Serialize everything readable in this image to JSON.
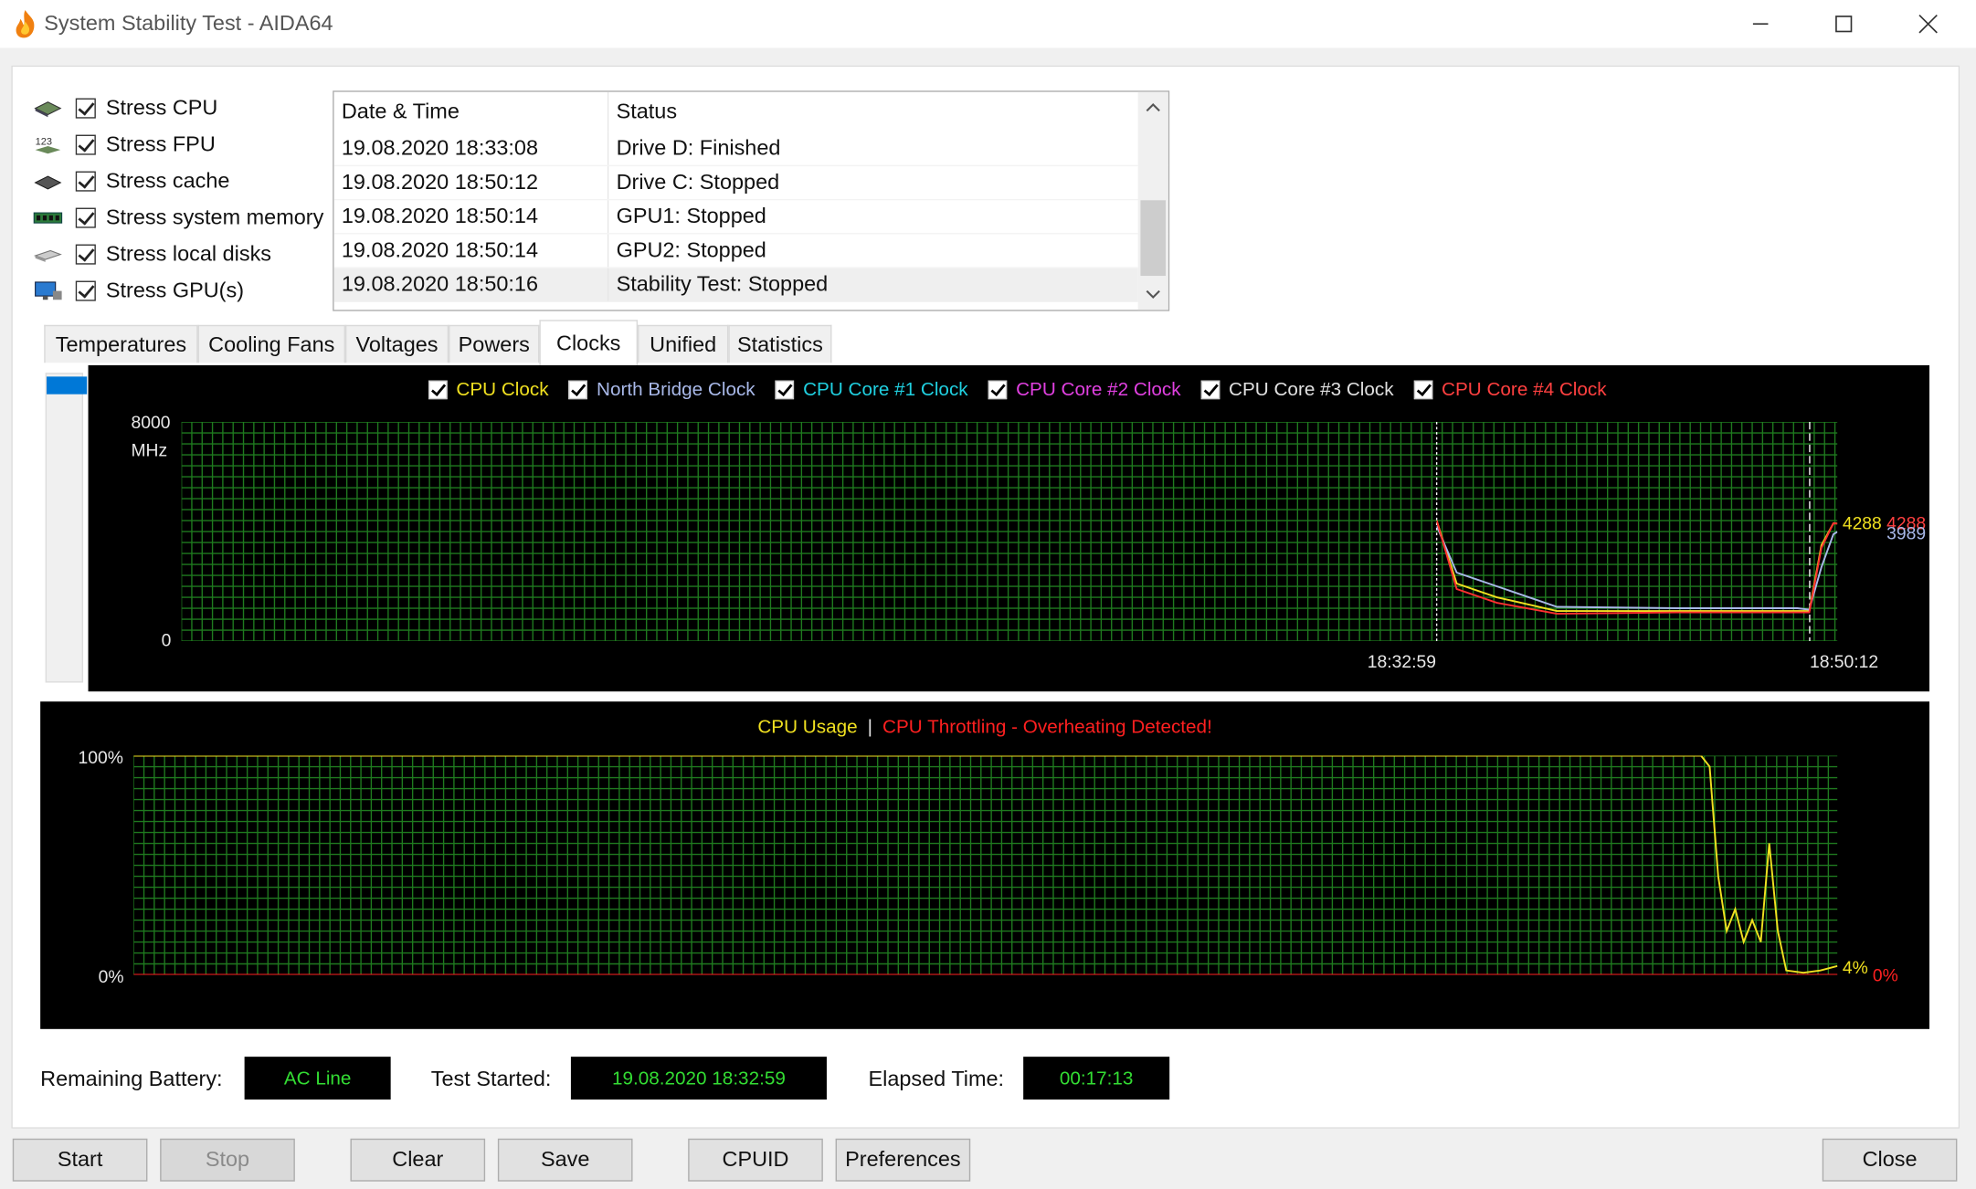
{
  "window": {
    "title": "System Stability Test - AIDA64"
  },
  "stress_options": [
    {
      "label": "Stress CPU",
      "checked": true,
      "icon": "cpu-icon"
    },
    {
      "label": "Stress FPU",
      "checked": true,
      "icon": "fpu-icon"
    },
    {
      "label": "Stress cache",
      "checked": true,
      "icon": "cache-icon"
    },
    {
      "label": "Stress system memory",
      "checked": true,
      "icon": "memory-icon"
    },
    {
      "label": "Stress local disks",
      "checked": true,
      "icon": "disk-icon"
    },
    {
      "label": "Stress GPU(s)",
      "checked": true,
      "icon": "gpu-icon"
    }
  ],
  "log": {
    "columns": [
      "Date & Time",
      "Status"
    ],
    "rows": [
      [
        "19.08.2020 18:33:08",
        "Drive D: Finished"
      ],
      [
        "19.08.2020 18:50:12",
        "Drive C: Stopped"
      ],
      [
        "19.08.2020 18:50:14",
        "GPU1: Stopped"
      ],
      [
        "19.08.2020 18:50:14",
        "GPU2: Stopped"
      ],
      [
        "19.08.2020 18:50:16",
        "Stability Test: Stopped"
      ]
    ]
  },
  "tabs": [
    "Temperatures",
    "Cooling Fans",
    "Voltages",
    "Powers",
    "Clocks",
    "Unified",
    "Statistics"
  ],
  "active_tab": "Clocks",
  "clock_graph": {
    "legend": [
      {
        "label": "CPU Clock",
        "color": "#f0e020"
      },
      {
        "label": "North Bridge Clock",
        "color": "#a8b8e8"
      },
      {
        "label": "CPU Core #1 Clock",
        "color": "#20d0e0"
      },
      {
        "label": "CPU Core #2 Clock",
        "color": "#e040e0"
      },
      {
        "label": "CPU Core #3 Clock",
        "color": "#e0e0e0"
      },
      {
        "label": "CPU Core #4 Clock",
        "color": "#ff3030"
      }
    ],
    "y_max": "8000",
    "y_unit": "MHz",
    "y_min": "0",
    "x_labels": [
      "18:32:59",
      "18:50:12"
    ],
    "end_values": [
      {
        "text": "4288",
        "color": "#f0e020"
      },
      {
        "text": "4288",
        "color": "#ff4040"
      },
      {
        "text": "3989",
        "color": "#a8b8e8"
      }
    ],
    "grid_color": "#1f7a1f"
  },
  "usage_graph": {
    "title_usage": "CPU Usage",
    "separator": "|",
    "title_throttle": "CPU Throttling - Overheating Detected!",
    "usage_color": "#f0e020",
    "throttle_color": "#ff2020",
    "y_max": "100%",
    "y_min": "0%",
    "end_usage": "4%",
    "end_throttle": "0%"
  },
  "chart_data": [
    {
      "type": "line",
      "ylim": [
        0,
        8000
      ],
      "ylabel": "MHz",
      "x_ticks": [
        "18:32:59",
        "18:50:12"
      ],
      "series": [
        {
          "name": "CPU Clock",
          "x": [
            0,
            0.05,
            0.15,
            0.3,
            0.6,
            0.9,
            0.93,
            0.96,
            0.99,
            1.0
          ],
          "values": [
            4400,
            2100,
            1600,
            1100,
            1100,
            1100,
            1100,
            3500,
            4300,
            4288
          ]
        },
        {
          "name": "North Bridge Clock",
          "x": [
            0,
            0.05,
            0.15,
            0.3,
            0.6,
            0.9,
            0.93,
            0.96,
            0.99,
            1.0
          ],
          "values": [
            4200,
            2500,
            2000,
            1250,
            1200,
            1200,
            1150,
            2700,
            3900,
            3989
          ]
        },
        {
          "name": "CPU Core #4 Clock",
          "x": [
            0,
            0.05,
            0.15,
            0.3,
            0.6,
            0.9,
            0.93,
            0.96,
            0.99,
            1.0
          ],
          "values": [
            4400,
            1900,
            1400,
            1000,
            1050,
            1050,
            1050,
            3400,
            4300,
            4288
          ]
        }
      ]
    },
    {
      "type": "line",
      "ylim": [
        0,
        100
      ],
      "y_ticks": [
        "0%",
        "100%"
      ],
      "series": [
        {
          "name": "CPU Usage",
          "x": [
            0,
            0.92,
            0.925,
            0.93,
            0.935,
            0.94,
            0.945,
            0.95,
            0.955,
            0.96,
            0.965,
            0.97,
            0.98,
            0.99,
            1.0
          ],
          "values": [
            100,
            100,
            95,
            45,
            20,
            30,
            15,
            25,
            15,
            60,
            20,
            2,
            1,
            2,
            4
          ]
        },
        {
          "name": "CPU Throttling - Overheating Detected!",
          "x": [
            0,
            1.0
          ],
          "values": [
            0,
            0
          ]
        }
      ]
    }
  ],
  "status": {
    "battery_label": "Remaining Battery:",
    "battery_value": "AC Line",
    "started_label": "Test Started:",
    "started_value": "19.08.2020 18:32:59",
    "elapsed_label": "Elapsed Time:",
    "elapsed_value": "00:17:13"
  },
  "buttons": {
    "start": "Start",
    "stop": "Stop",
    "clear": "Clear",
    "save": "Save",
    "cpuid": "CPUID",
    "preferences": "Preferences",
    "close": "Close"
  }
}
